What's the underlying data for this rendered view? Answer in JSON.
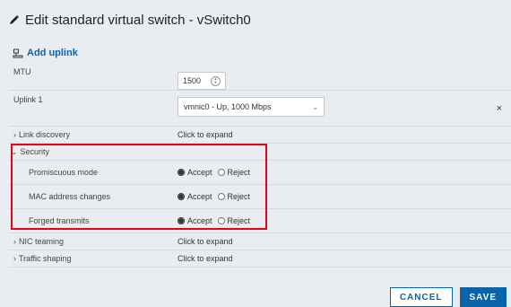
{
  "dialog": {
    "title": "Edit standard virtual switch - vSwitch0",
    "add_uplink": "Add uplink"
  },
  "rows": {
    "mtu": {
      "label": "MTU",
      "value": "1500"
    },
    "uplink": {
      "label": "Uplink 1",
      "value": "vmnic0 - Up, 1000 Mbps",
      "remove": "×"
    },
    "link_discovery": {
      "label": "Link discovery",
      "value": "Click to expand"
    },
    "security": {
      "label": "Security",
      "promiscuous": {
        "label": "Promiscuous mode",
        "accept": "Accept",
        "reject": "Reject",
        "selected": "Accept"
      },
      "mac_changes": {
        "label": "MAC address changes",
        "accept": "Accept",
        "reject": "Reject",
        "selected": "Accept"
      },
      "forged": {
        "label": "Forged transmits",
        "accept": "Accept",
        "reject": "Reject",
        "selected": "Accept"
      }
    },
    "nic_teaming": {
      "label": "NIC teaming",
      "value": "Click to expand"
    },
    "traffic_shaping": {
      "label": "Traffic shaping",
      "value": "Click to expand"
    }
  },
  "footer": {
    "cancel": "CANCEL",
    "save": "SAVE"
  },
  "colors": {
    "accent": "#0b63a8",
    "highlight": "#e30613",
    "background": "#e9ecf1"
  },
  "icons": {
    "title_icon": "pencil-icon",
    "add_uplink_icon": "network-adapter-icon"
  }
}
